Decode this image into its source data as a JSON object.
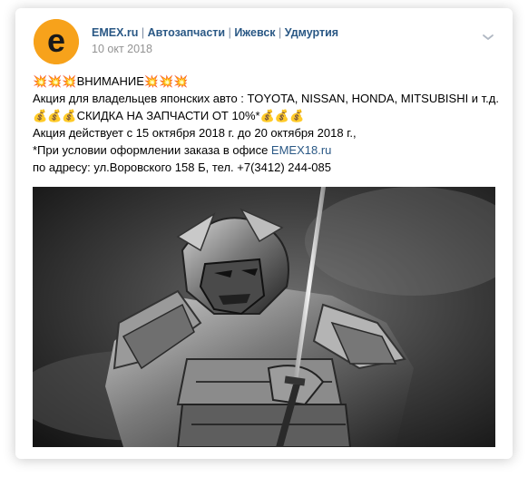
{
  "post": {
    "author": {
      "name": "EMEX.ru",
      "tags": [
        "Автозапчасти",
        "Ижевск",
        "Удмуртия"
      ],
      "separator": " | ",
      "avatar_letter": "e",
      "avatar_color": "#f7a21b"
    },
    "date": "10 окт 2018",
    "lines": {
      "l1_emoji_left": "💥💥💥",
      "l1_text": "ВНИМАНИЕ",
      "l1_emoji_right": "💥💥💥",
      "l2": "Акция для владельцев японских авто : TOYOTA, NISSAN, HONDA, MITSUBISHI и т.д.",
      "l3_emoji_left": "💰💰💰",
      "l3_text": "СКИДКА НА ЗАПЧАСТИ ОТ 10%*",
      "l3_emoji_right": "💰💰💰",
      "l4": "Акция действует с 15 октября 2018 г. до 20 октября 2018 г.,",
      "l5_prefix": "*При условии оформлении заказа в офисе ",
      "l5_link": "EMEX18.ru",
      "l6": "по адресу: ул.Воровского 158 Б, тел. +7(3412) 244-085"
    },
    "image": {
      "subject": "samurai-armor-warrior-with-sword"
    }
  },
  "colors": {
    "link": "#2a5885",
    "muted": "#939393",
    "accent": "#f7a21b"
  }
}
